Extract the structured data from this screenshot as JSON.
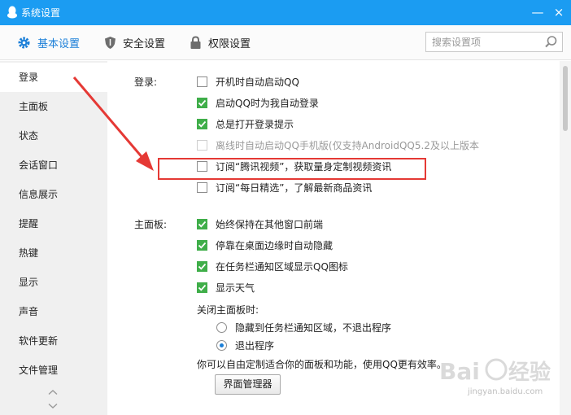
{
  "window": {
    "title": "系统设置",
    "min_label": "—",
    "close_label": "×"
  },
  "tabs": [
    {
      "label": "基本设置",
      "icon": "gear-icon"
    },
    {
      "label": "安全设置",
      "icon": "shield-icon"
    },
    {
      "label": "权限设置",
      "icon": "lock-icon"
    }
  ],
  "search": {
    "placeholder": "搜索设置项",
    "value": ""
  },
  "sidebar": {
    "items": [
      {
        "label": "登录",
        "active": true
      },
      {
        "label": "主面板"
      },
      {
        "label": "状态"
      },
      {
        "label": "会话窗口"
      },
      {
        "label": "信息展示"
      },
      {
        "label": "提醒"
      },
      {
        "label": "热键"
      },
      {
        "label": "显示"
      },
      {
        "label": "声音"
      },
      {
        "label": "软件更新"
      },
      {
        "label": "文件管理"
      }
    ],
    "scroll_up": "︿",
    "scroll_down": "﹀"
  },
  "login": {
    "label": "登录:",
    "options": [
      {
        "label": "开机时自动启动QQ",
        "checked": false
      },
      {
        "label": "启动QQ时为我自动登录",
        "checked": true
      },
      {
        "label": "总是打开登录提示",
        "checked": true
      },
      {
        "label": "离线时自动启动QQ手机版(仅支持AndroidQQ5.2及以上版本",
        "checked": false,
        "disabled": true
      },
      {
        "label": "订阅“腾讯视频”，获取量身定制视频资讯",
        "checked": false,
        "highlighted": true
      },
      {
        "label": "订阅“每日精选”，了解最新商品资讯",
        "checked": false
      }
    ]
  },
  "mainpanel": {
    "label": "主面板:",
    "options": [
      {
        "label": "始终保持在其他窗口前端",
        "checked": true
      },
      {
        "label": "停靠在桌面边缘时自动隐藏",
        "checked": true
      },
      {
        "label": "在任务栏通知区域显示QQ图标",
        "checked": true
      },
      {
        "label": "显示天气",
        "checked": true
      }
    ],
    "close_label": "关闭主面板时:",
    "close_options": [
      {
        "label": "隐藏到任务栏通知区域，不退出程序",
        "selected": false
      },
      {
        "label": "退出程序",
        "selected": true
      }
    ],
    "hint": "你可以自由定制适合你的面板和功能，使用QQ更有效率。",
    "manager_button": "界面管理器"
  },
  "watermark": {
    "brand": "Baidu经验",
    "url": "jingyan.baidu.com"
  },
  "colors": {
    "titlebar": "#1b9cf2",
    "checkbox_on": "#3fae49",
    "highlight_box": "#e53935",
    "sidebar_bg": "#f0f0f0"
  }
}
